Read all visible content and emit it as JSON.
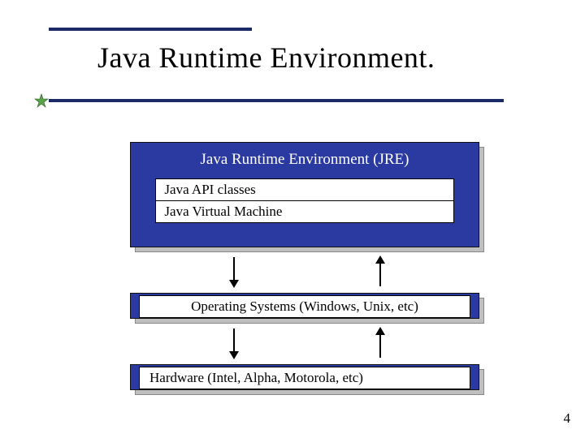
{
  "title": "Java Runtime Environment.",
  "diagram": {
    "jre_label": "Java Runtime Environment (JRE)",
    "api_label": "Java API classes",
    "jvm_label": "Java Virtual Machine",
    "os_label": "Operating Systems (Windows, Unix, etc)",
    "hw_label": "Hardware (Intel, Alpha, Motorola, etc)"
  },
  "page_number": "4",
  "colors": {
    "block_blue": "#2b3aa0",
    "rule_navy": "#1a2a66",
    "shadow_gray": "#bfbfbf"
  }
}
